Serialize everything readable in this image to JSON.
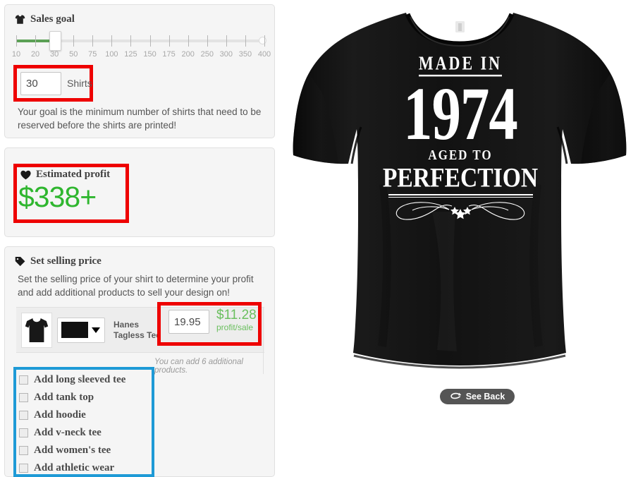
{
  "sales_goal": {
    "title": "Sales goal",
    "icon": "tshirt-icon",
    "slider": {
      "ticks": [
        10,
        20,
        30,
        50,
        75,
        100,
        125,
        150,
        175,
        200,
        250,
        300,
        350,
        400
      ],
      "value": 30,
      "min": 10,
      "max": 400
    },
    "shirts_value": "30",
    "shirts_unit": "Shirts",
    "help_text": "Your goal is the minimum number of shirts that need to be reserved before the shirts are printed!"
  },
  "estimated_profit": {
    "title": "Estimated profit",
    "icon": "heart-icon",
    "amount": "$338+",
    "amount_color": "#2fb62f"
  },
  "selling_price": {
    "title": "Set selling price",
    "icon": "price-tag-icon",
    "description": "Set the selling price of your shirt to determine your profit and add additional products to sell your design on!",
    "product": {
      "name": "Hanes Tagless Tee",
      "color_value": "#111111",
      "price_value": "19.95",
      "profit_amount": "$11.28",
      "profit_label": "profit/sale"
    },
    "additional_note": "You can add 6 additional products.",
    "checkboxes": [
      {
        "label": "Add long sleeved tee",
        "checked": false
      },
      {
        "label": "Add tank top",
        "checked": false
      },
      {
        "label": "Add hoodie",
        "checked": false
      },
      {
        "label": "Add v-neck tee",
        "checked": false
      },
      {
        "label": "Add women's tee",
        "checked": false
      },
      {
        "label": "Add athletic wear",
        "checked": false
      }
    ]
  },
  "preview": {
    "shirt_color": "#0e0e0e",
    "design": {
      "line1": "MADE IN",
      "year": "1974",
      "line2": "AGED TO",
      "line3": "PERFECTION"
    },
    "see_back_label": "See Back",
    "see_back_icon": "flip-arrow-icon"
  },
  "highlights": {
    "red": "#ee0000",
    "blue": "#1e9ad6"
  }
}
